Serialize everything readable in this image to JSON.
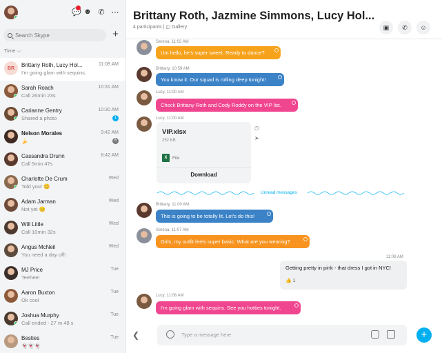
{
  "sidebar": {
    "search_placeholder": "Search Skype",
    "sort_label": "Time ⌵",
    "items": [
      {
        "initials": "BR",
        "name": "Brittany Roth, Lucy Hol...",
        "preview": "I'm going glam with sequins.",
        "time": "11:08 AM",
        "active": true,
        "bold": false,
        "count": "",
        "color": "#f6dcd5"
      },
      {
        "name": "Sarah Roach",
        "preview": "Call 26min 23s",
        "time": "10:31 AM",
        "bold": false,
        "count": "",
        "color": "#8b5a3c"
      },
      {
        "name": "Carianne Gentry",
        "preview": "Shared a photo",
        "time": "10:30 AM",
        "bold": false,
        "count": "1",
        "color": "#6b4a35"
      },
      {
        "name": "Nelson Morales",
        "preview": "🍌",
        "time": "9:42 AM",
        "bold": true,
        "count": "6",
        "color": "#3d2a22"
      },
      {
        "name": "Cassandra Drunn",
        "preview": "Call 5min 47s",
        "time": "8:42 AM",
        "bold": false,
        "count": "",
        "color": "#5a3a2e"
      },
      {
        "name": "Charlotte De Crum",
        "preview": "Told you! 😊",
        "time": "Wed",
        "bold": false,
        "count": "",
        "color": "#8a6a4f"
      },
      {
        "name": "Adam Jarman",
        "preview": "Not yet 😐",
        "time": "Wed",
        "bold": false,
        "count": "",
        "color": "#6e4b3a"
      },
      {
        "name": "Will Little",
        "preview": "Call 10min 32s",
        "time": "Wed",
        "bold": false,
        "count": "",
        "color": "#4c3a30"
      },
      {
        "name": "Angus McNeil",
        "preview": "You need a day off!",
        "time": "Wed",
        "bold": false,
        "count": "",
        "color": "#5c4a3c"
      },
      {
        "name": "MJ Price",
        "preview": "Teehee!",
        "time": "Tue",
        "bold": false,
        "count": "",
        "color": "#3a2e2a"
      },
      {
        "name": "Aaron Buxton",
        "preview": "Ok cool",
        "time": "Tue",
        "bold": false,
        "count": "",
        "color": "#8c5a3a"
      },
      {
        "name": "Joshua Murphy",
        "preview": "Call ended - 27 m 48 s",
        "time": "Tue",
        "bold": false,
        "count": "",
        "color": "#4a3a2e"
      },
      {
        "name": "Besties",
        "preview": "👻👻👻",
        "time": "Tue",
        "bold": false,
        "count": "",
        "color": "#b89a80"
      }
    ]
  },
  "header": {
    "title": "Brittany Roth, Jazmine Simmons, Lucy Hol...",
    "participants": "4 participants",
    "gallery": "Gallery"
  },
  "messages": [
    {
      "meta": "Serena, 11:02 AM",
      "text": "Um hello, he's super sweet. Ready to dance?",
      "color": "#f7a21b"
    },
    {
      "meta": "Brittany, 10:59 AM",
      "text": "You know it. Our squad is rolling deep tonight!",
      "color": "#3b82c7"
    },
    {
      "meta": "Lucy, 11:00 AM",
      "text": "Check Brittany Roth and Cody Roddy on the VIP list.",
      "color": "#f0468f"
    },
    {
      "meta": "Lucy, 11:00 AM",
      "file": {
        "name": "VIP.xlsx",
        "size": "252 KB",
        "type": "File",
        "download": "Download"
      }
    },
    {
      "meta": "Brittany, 11:00 AM",
      "text": "This is going to be totally lit. Let's do this!",
      "color": "#3b82c7"
    },
    {
      "meta": "Serena, 11:07 AM",
      "text": "Girls, my outfit feels super basic. What are you wearing?",
      "color": "#f7931e"
    },
    {
      "meta": "11:08 AM",
      "text": "Getting pretty in pink - that dress I got in NYC!",
      "reaction": "👍 1"
    },
    {
      "meta": "Lucy, 11:08 AM",
      "text": "I'm going glam with sequins. See you hotties tonight.",
      "color": "#f0468f"
    }
  ],
  "unread_label": "Unread messages",
  "compose_placeholder": "Type a message here"
}
